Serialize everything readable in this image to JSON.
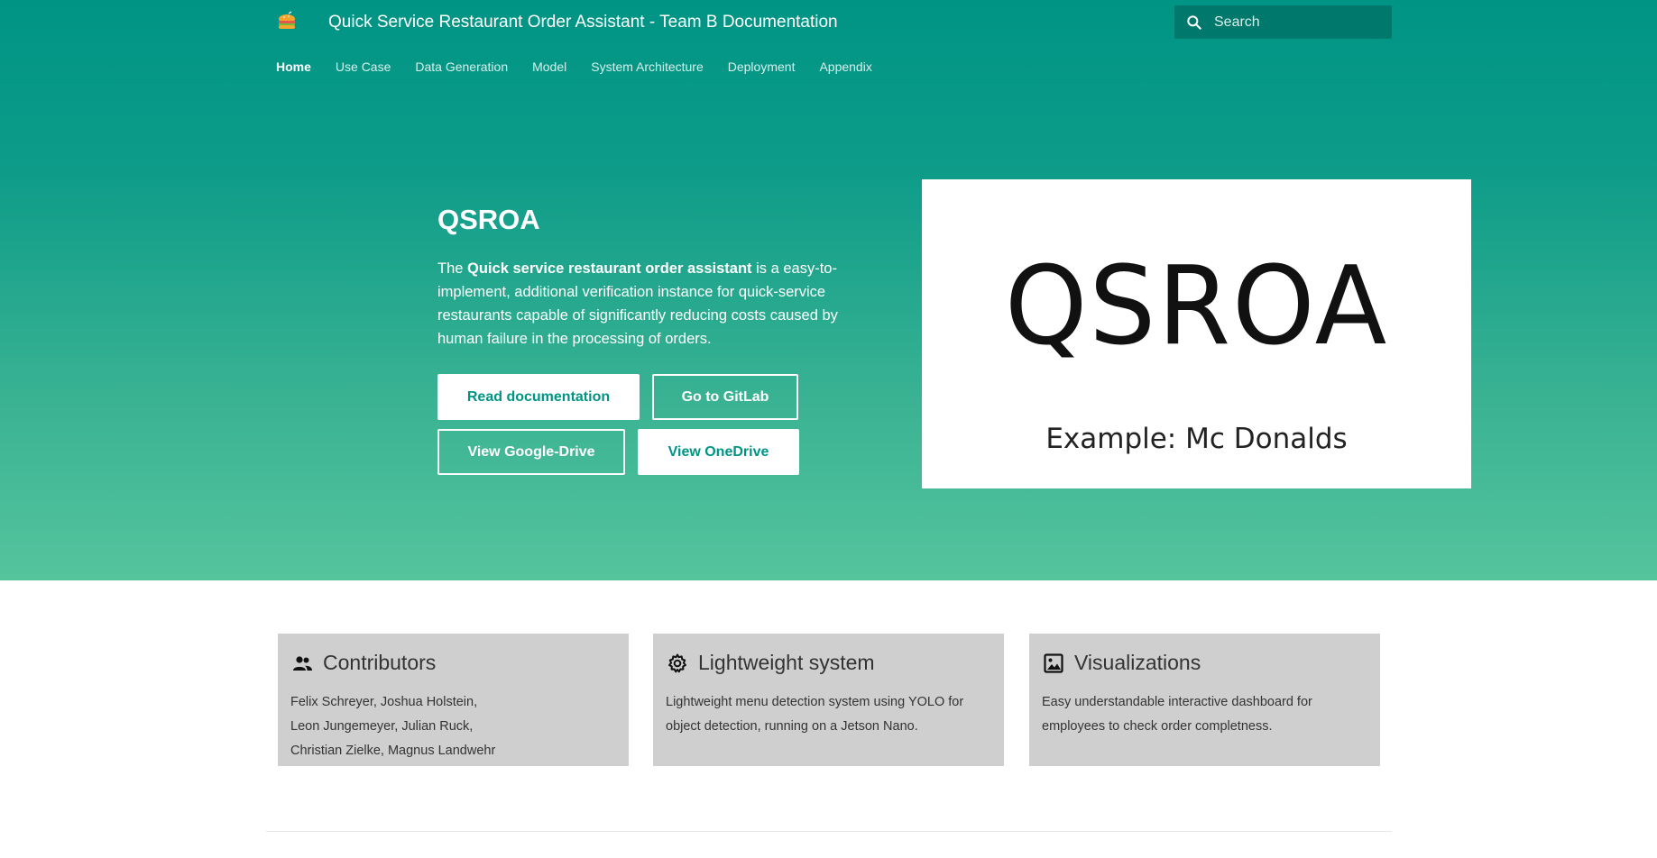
{
  "header": {
    "title": "Quick Service Restaurant Order Assistant - Team B Documentation",
    "logo_icon": "burger-logo-icon",
    "search": {
      "placeholder": "Search",
      "value": ""
    }
  },
  "tabs": [
    {
      "label": "Home",
      "active": true
    },
    {
      "label": "Use Case",
      "active": false
    },
    {
      "label": "Data Generation",
      "active": false
    },
    {
      "label": "Model",
      "active": false
    },
    {
      "label": "System Architecture",
      "active": false
    },
    {
      "label": "Deployment",
      "active": false
    },
    {
      "label": "Appendix",
      "active": false
    }
  ],
  "hero": {
    "title": "QSROA",
    "desc_prefix": "The ",
    "desc_bold": "Quick service restaurant order assistant",
    "desc_suffix": " is a easy-to-implement, additional verification instance for quick-service restaurants capable of significantly reducing costs caused by human failure in the processing of orders.",
    "buttons": {
      "read": "Read documentation",
      "gitlab": "Go to GitLab",
      "gdrive": "View Google-Drive",
      "onedrive": "View OneDrive"
    },
    "image": {
      "big_text": "QSROA",
      "sub_text": "Example: Mc Donalds"
    }
  },
  "features": [
    {
      "icon": "people-icon",
      "title": "Contributors",
      "lines": [
        "Felix Schreyer, Joshua Holstein,",
        "Leon Jungemeyer, Julian Ruck,",
        "Christian Zielke, Magnus Landwehr"
      ]
    },
    {
      "icon": "gear-icon",
      "title": "Lightweight system",
      "lines": [
        "Lightweight menu detection system using YOLO for",
        "object detection, running on a Jetson Nano."
      ]
    },
    {
      "icon": "image-icon",
      "title": "Visualizations",
      "lines": [
        "Easy understandable interactive dashboard for",
        "employees to check order completness."
      ]
    }
  ],
  "colors": {
    "primary": "#009485",
    "primary_dark": "#00786c",
    "hero_bottom": "#54c49d",
    "card_bg": "#cfcfcf"
  }
}
